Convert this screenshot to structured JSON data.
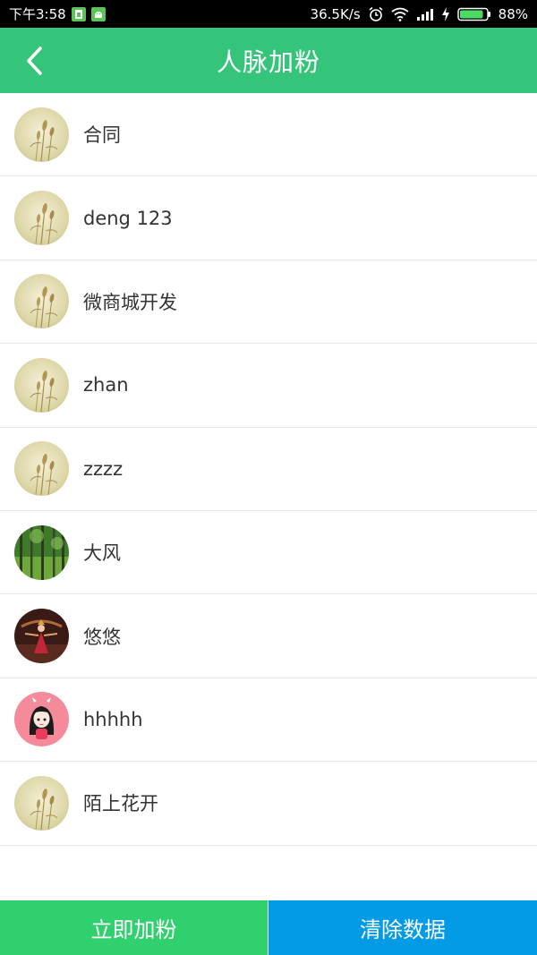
{
  "status_bar": {
    "time": "下午3:58",
    "network_speed": "36.5K/s",
    "battery_percent": "88%",
    "battery_level": 0.88,
    "icons": [
      "sim-icon",
      "android-icon",
      "alarm-icon",
      "wifi-icon",
      "signal-icon",
      "charging-icon",
      "battery-icon"
    ]
  },
  "header": {
    "title": "人脉加粉",
    "back_icon": "chevron-left-icon",
    "background": "#34c47a"
  },
  "contacts": [
    {
      "name": "合同",
      "avatar": "wheat-avatar"
    },
    {
      "name": "deng 123",
      "avatar": "wheat-avatar"
    },
    {
      "name": "微商城开发",
      "avatar": "wheat-avatar"
    },
    {
      "name": "zhan",
      "avatar": "wheat-avatar"
    },
    {
      "name": "zzzz",
      "avatar": "wheat-avatar"
    },
    {
      "name": "大风",
      "avatar": "forest-avatar"
    },
    {
      "name": "悠悠",
      "avatar": "dancer-avatar"
    },
    {
      "name": "hhhhh",
      "avatar": "cartoon-girl-avatar"
    },
    {
      "name": "陌上花开",
      "avatar": "wheat-avatar"
    }
  ],
  "bottom_bar": {
    "add_label": "立即加粉",
    "clear_label": "清除数据",
    "add_color": "#2fd06d",
    "clear_color": "#039be5"
  }
}
